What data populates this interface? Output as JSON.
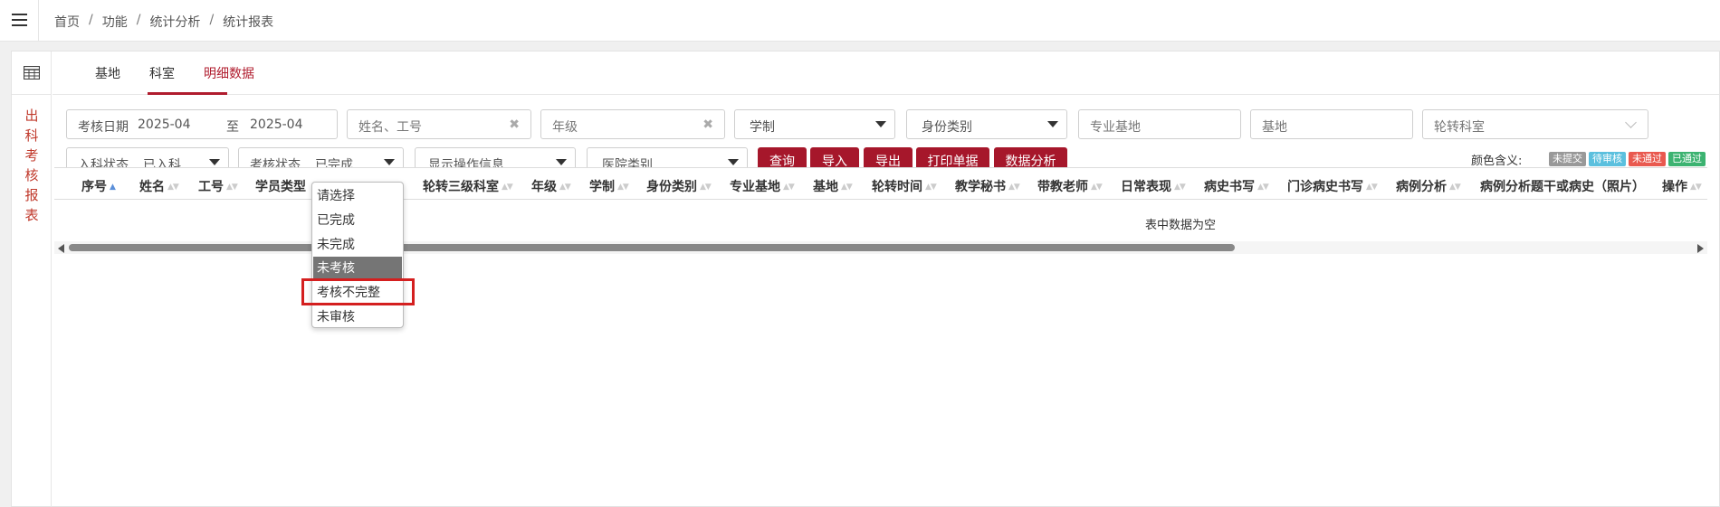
{
  "breadcrumb": [
    "首页",
    "功能",
    "统计分析",
    "统计报表"
  ],
  "breadcrumb_separator": "/",
  "side_title": [
    "出",
    "科",
    "考",
    "核",
    "报",
    "表"
  ],
  "tabs": [
    {
      "label": "基地"
    },
    {
      "label": "科室"
    },
    {
      "label": "明细数据",
      "active": true
    }
  ],
  "filters": {
    "date_label": "考核日期",
    "date_from": "2025-04",
    "date_to_label": "至",
    "date_to": "2025-04",
    "name_placeholder": "姓名、工号",
    "grade_placeholder": "年级",
    "system_select": "学制",
    "identity_select": "身份类别",
    "major_base_placeholder": "专业基地",
    "base_placeholder": "基地",
    "rotation_dept_placeholder": "轮转科室",
    "admission_label": "入科状态",
    "admission_value": "已入科",
    "exam_label": "考核状态",
    "exam_value": "已完成",
    "show_ops_select": "显示操作信息",
    "hospital_type_select": "医院类别"
  },
  "buttons": {
    "query": "查询",
    "import": "导入",
    "export": "导出",
    "print": "打印单据",
    "analysis": "数据分析"
  },
  "legend": {
    "label": "颜色含义:",
    "items": [
      {
        "text": "未提交",
        "color": "#999999"
      },
      {
        "text": "待审核",
        "color": "#5bc0de"
      },
      {
        "text": "未通过",
        "color": "#e9594f"
      },
      {
        "text": "已通过",
        "color": "#3cb371"
      }
    ]
  },
  "table": {
    "columns": [
      "序号",
      "姓名",
      "工号",
      "学员类型",
      "轮转三级科室",
      "年级",
      "学制",
      "身份类别",
      "专业基地",
      "基地",
      "轮转时间",
      "教学秘书",
      "带教老师",
      "日常表现",
      "病史书写",
      "门诊病史书写",
      "病例分析",
      "病例分析题干或病史（照片）",
      "操作"
    ],
    "empty_text": "表中数据为空"
  },
  "dropdown": {
    "options": [
      "请选择",
      "已完成",
      "未完成",
      "未考核",
      "考核不完整",
      "未审核"
    ],
    "highlighted": "未考核",
    "boxed": "考核不完整"
  },
  "colors": {
    "accent": "#a6172b",
    "side_title": "#c0392b",
    "highlight_box": "#d41f1f"
  }
}
